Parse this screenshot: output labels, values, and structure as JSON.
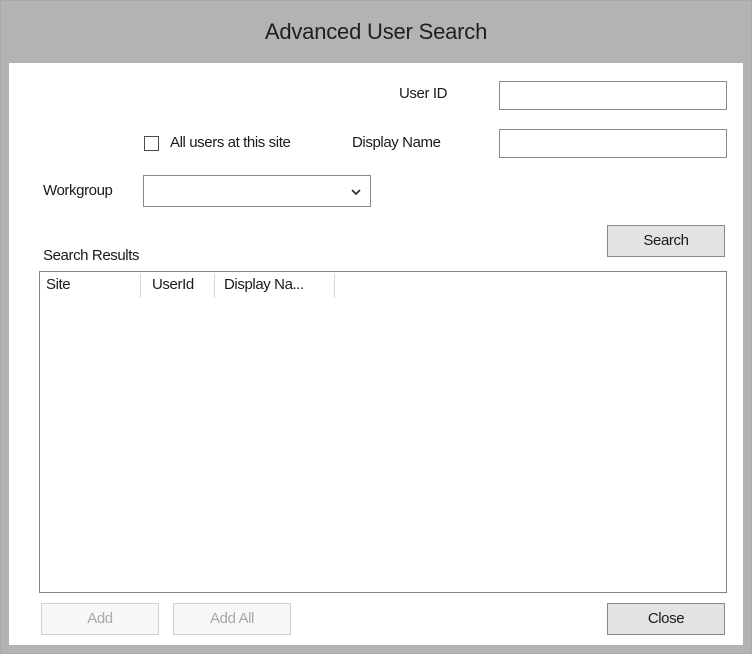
{
  "window": {
    "title": "Advanced User Search"
  },
  "form": {
    "user_id_label": "User ID",
    "user_id_value": "",
    "display_name_label": "Display Name",
    "display_name_value": "",
    "all_users_label": "All users at this site",
    "all_users_checked": false,
    "workgroup_label": "Workgroup",
    "workgroup_value": ""
  },
  "buttons": {
    "search": "Search",
    "add": "Add",
    "add_all": "Add All",
    "close": "Close"
  },
  "results": {
    "label": "Search Results",
    "columns": [
      "Site",
      "UserId",
      "Display Na..."
    ],
    "rows": []
  },
  "icons": {
    "combo_arrow": "chevron-down-icon"
  },
  "colors": {
    "titlebar": "#b3b3b3",
    "disabled_text": "#a8a8a8"
  }
}
